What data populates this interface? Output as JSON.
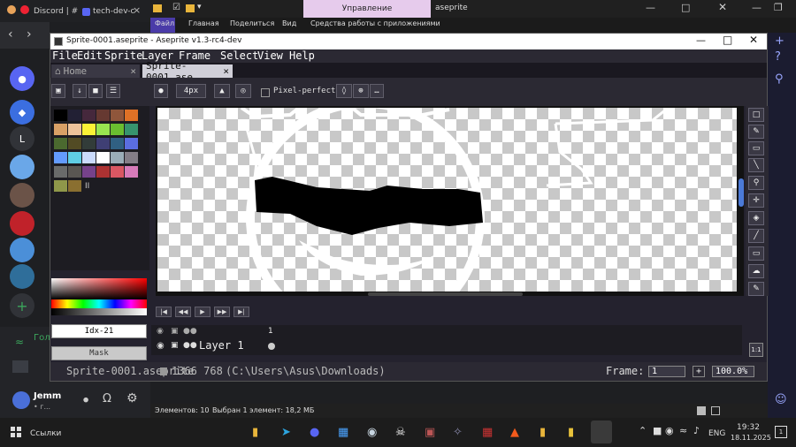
{
  "browser": {
    "tabs": [
      {
        "label": "Discord | #",
        "close": "×"
      },
      {
        "label": "tech-dev-c",
        "close": "×"
      }
    ],
    "add_tab": "+"
  },
  "explorer": {
    "context_tab": "Управление",
    "window_title": "aseprite",
    "ribbon": [
      "Файл",
      "Главная",
      "Поделиться",
      "Вид",
      "Средства работы с приложениями"
    ],
    "status_items": "Элементов: 10",
    "status_selected": "Выбран 1 элемент: 18,2 МБ"
  },
  "discord": {
    "server_letter": "L",
    "channel_partial": "Гол",
    "username_partial": "Jemm",
    "status_partial": "• г..."
  },
  "aseprite": {
    "title": "Sprite-0001.aseprite - Aseprite v1.3-rc4-dev",
    "menu": [
      "File",
      "Edit",
      "Sprite",
      "Layer",
      "Frame",
      "Select",
      "View",
      "Help"
    ],
    "tabs": [
      {
        "label": "Home",
        "close": "×"
      },
      {
        "label": "Sprite-0001.ase",
        "close": "×"
      }
    ],
    "toolbar": {
      "brush_size": "4px",
      "pixel_perfect_label": "Pixel-perfect",
      "more": "…"
    },
    "palette": {
      "colors": [
        "#000000",
        "#222034",
        "#45283c",
        "#663931",
        "#8f563b",
        "#df7126",
        "#d9a066",
        "#eec39a",
        "#fbf236",
        "#99e550",
        "#6abe30",
        "#37946e",
        "#4b692f",
        "#524b24",
        "#323c39",
        "#3f3f74",
        "#306082",
        "#5b6ee1",
        "#639bff",
        "#5fcde4",
        "#cbdbfc",
        "#ffffff",
        "#9badb7",
        "#847e87",
        "#696a6a",
        "#595652",
        "#76428a",
        "#ac3232",
        "#d95763",
        "#d77bba",
        "#8f974a",
        "#8a6f30"
      ],
      "pause_label": "II"
    },
    "fg_label": "Idx-21",
    "bg_label": "Mask",
    "layer": {
      "frame_number": "1",
      "name": "Layer 1"
    },
    "status": {
      "file": "Sprite-0001.aseprite",
      "size": "1366 768",
      "path": "(C:\\Users\\Asus\\Downloads)",
      "frame_label": "Frame:",
      "frame_value": "1",
      "zoom": "100.0%",
      "zoom_plus": "+"
    }
  },
  "taskbar": {
    "search_label": "Ссылки",
    "lang": "ENG",
    "time": "19:32",
    "date": "18.11.2025",
    "notification_count": "1"
  },
  "colors": {
    "accent": "#5865f2",
    "ase_panel": "#2b2933"
  }
}
